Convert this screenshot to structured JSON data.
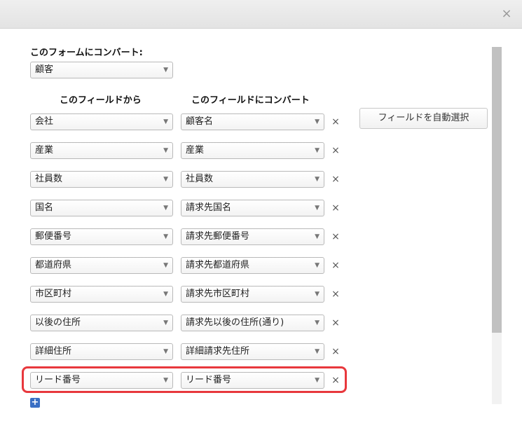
{
  "dialog": {
    "close_label": "×",
    "convert_form_label": "このフォームにコンバート:",
    "convert_form_value": "顧客",
    "from_header": "このフィールドから",
    "to_header": "このフィールドにコンバート",
    "auto_select_label": "フィールドを自動選択",
    "add_label": "+",
    "remove_label": "×",
    "arrow": "▼",
    "rows": [
      {
        "from": "会社",
        "to": "顧客名"
      },
      {
        "from": "産業",
        "to": "産業"
      },
      {
        "from": "社員数",
        "to": "社員数"
      },
      {
        "from": "国名",
        "to": "請求先国名"
      },
      {
        "from": "郵便番号",
        "to": "請求先郵便番号"
      },
      {
        "from": "都道府県",
        "to": "請求先都道府県"
      },
      {
        "from": "市区町村",
        "to": "請求先市区町村"
      },
      {
        "from": "以後の住所",
        "to": "請求先以後の住所(通り)"
      },
      {
        "from": "詳細住所",
        "to": "詳細請求先住所"
      },
      {
        "from": "リード番号",
        "to": "リード番号"
      }
    ],
    "colors": {
      "highlight": "#e8383d",
      "add_button": "#3a6fc4"
    }
  }
}
